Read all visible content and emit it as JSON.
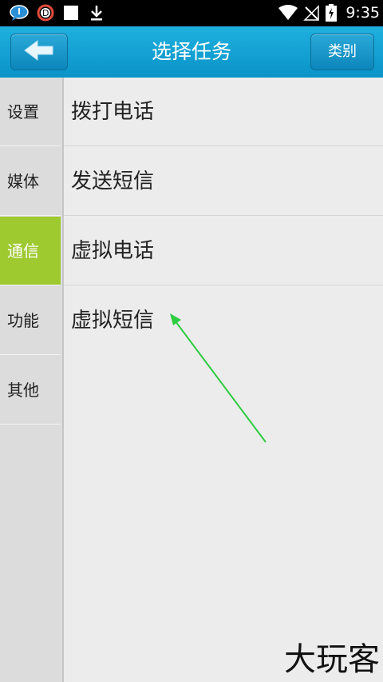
{
  "status_bar": {
    "time": "9:35",
    "icons": [
      "chat-bubble-icon",
      "dropbox-d-icon",
      "blank-notification-icon",
      "download-icon",
      "wifi-icon",
      "no-signal-icon",
      "battery-charging-icon"
    ]
  },
  "header": {
    "back_icon": "back-arrow-icon",
    "title": "选择任务",
    "category_label": "类别",
    "accent_color": "#0f9fd2"
  },
  "sidebar": {
    "items": [
      {
        "label": "设置",
        "active": false
      },
      {
        "label": "媒体",
        "active": false
      },
      {
        "label": "通信",
        "active": true
      },
      {
        "label": "功能",
        "active": false
      },
      {
        "label": "其他",
        "active": false
      }
    ],
    "active_color": "#9ec92f"
  },
  "tasks": [
    {
      "label": "拨打电话"
    },
    {
      "label": "发送短信"
    },
    {
      "label": "虚拟电话"
    },
    {
      "label": "虚拟短信"
    }
  ],
  "annotation": {
    "arrow_color": "#2ecc40"
  },
  "watermark": "大玩客"
}
